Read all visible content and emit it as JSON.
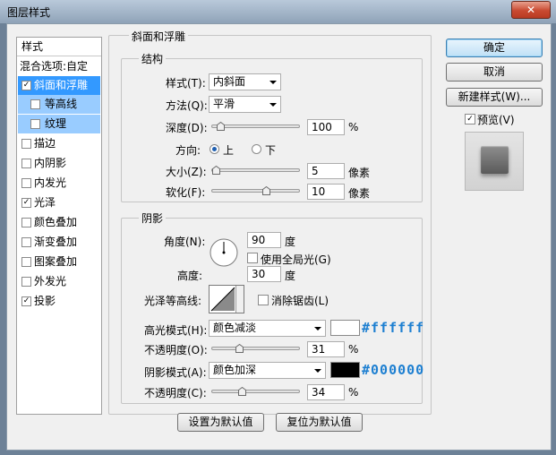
{
  "window": {
    "title": "图层样式",
    "close_label": "✕"
  },
  "sidebar": {
    "header": "样式",
    "blend_options": "混合选项:自定",
    "items": [
      {
        "label": "斜面和浮雕",
        "checked": true
      },
      {
        "label": "等高线",
        "checked": false
      },
      {
        "label": "纹理",
        "checked": false
      },
      {
        "label": "描边",
        "checked": false
      },
      {
        "label": "内阴影",
        "checked": false
      },
      {
        "label": "内发光",
        "checked": false
      },
      {
        "label": "光泽",
        "checked": true
      },
      {
        "label": "颜色叠加",
        "checked": false
      },
      {
        "label": "渐变叠加",
        "checked": false
      },
      {
        "label": "图案叠加",
        "checked": false
      },
      {
        "label": "外发光",
        "checked": false
      },
      {
        "label": "投影",
        "checked": true
      }
    ]
  },
  "bevel": {
    "group_title": "斜面和浮雕",
    "structure": {
      "title": "结构",
      "style_label": "样式(T):",
      "style_value": "内斜面",
      "technique_label": "方法(Q):",
      "technique_value": "平滑",
      "depth_label": "深度(D):",
      "depth_value": "100",
      "depth_unit": "%",
      "depth_fraction": 0.1,
      "direction_label": "方向:",
      "dir_up": "上",
      "dir_down": "下",
      "size_label": "大小(Z):",
      "size_value": "5",
      "size_unit": "像素",
      "size_fraction": 0.03,
      "soften_label": "软化(F):",
      "soften_value": "10",
      "soften_unit": "像素",
      "soften_fraction": 0.6
    },
    "shading": {
      "title": "阴影",
      "angle_label": "角度(N):",
      "angle_value": "90",
      "angle_unit": "度",
      "global_light_label": "使用全局光(G)",
      "altitude_label": "高度:",
      "altitude_value": "30",
      "altitude_unit": "度",
      "gloss_label": "光泽等高线:",
      "antialias_label": "消除锯齿(L)",
      "highlight_label": "高光模式(H):",
      "highlight_mode": "颜色减淡",
      "highlight_color": "#ffffff",
      "highlight_hex": "#ffffff",
      "highlight_opacity_label": "不透明度(O):",
      "highlight_opacity": "31",
      "highlight_opacity_unit": "%",
      "highlight_fraction": 0.31,
      "shadow_label": "阴影模式(A):",
      "shadow_mode": "颜色加深",
      "shadow_color": "#000000",
      "shadow_hex": "#000000",
      "shadow_opacity_label": "不透明度(C):",
      "shadow_opacity": "34",
      "shadow_opacity_unit": "%",
      "shadow_fraction": 0.34
    },
    "make_default": "设置为默认值",
    "reset_default": "复位为默认值"
  },
  "right": {
    "ok": "确定",
    "cancel": "取消",
    "new_style": "新建样式(W)...",
    "preview_label": "预览(V)"
  }
}
